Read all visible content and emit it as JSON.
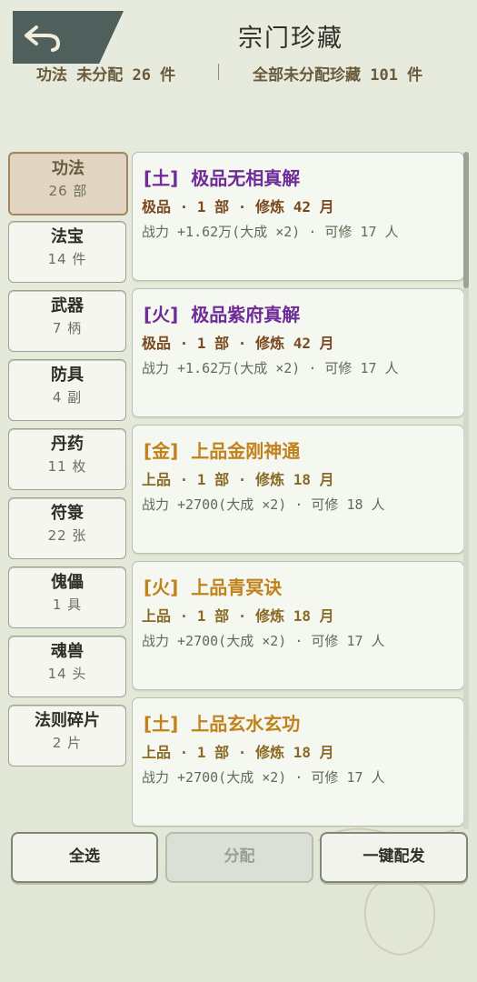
{
  "header": {
    "title": "宗门珍藏",
    "back_icon": "back-arrow-icon"
  },
  "summary": {
    "left": "功法 未分配 26 件",
    "right": "全部未分配珍藏 101 件"
  },
  "categories": [
    {
      "name": "功法",
      "count": "26 部",
      "active": true
    },
    {
      "name": "法宝",
      "count": "14 件"
    },
    {
      "name": "武器",
      "count": "7 柄"
    },
    {
      "name": "防具",
      "count": "4 副"
    },
    {
      "name": "丹药",
      "count": "11 枚"
    },
    {
      "name": "符箓",
      "count": "22 张"
    },
    {
      "name": "傀儡",
      "count": "1 具"
    },
    {
      "name": "魂兽",
      "count": "14 头"
    },
    {
      "name": "法则碎片",
      "count": "2 片"
    }
  ],
  "items": [
    {
      "element": "[土]",
      "name": "极品无相真解",
      "meta": "极品 · 1 部 · 修炼 42 月",
      "power": "战力 +1.62万(大成 ×2) · 可修 17 人",
      "tier_color": "#6f2c98"
    },
    {
      "element": "[火]",
      "name": "极品紫府真解",
      "meta": "极品 · 1 部 · 修炼 42 月",
      "power": "战力 +1.62万(大成 ×2) · 可修 17 人",
      "tier_color": "#6f2c98"
    },
    {
      "element": "[金]",
      "name": "上品金刚神通",
      "meta": "上品 · 1 部 · 修炼 18 月",
      "power": "战力 +2700(大成 ×2) · 可修 18 人",
      "tier_color": "#c1821c"
    },
    {
      "element": "[火]",
      "name": "上品青冥诀",
      "meta": "上品 · 1 部 · 修炼 18 月",
      "power": "战力 +2700(大成 ×2) · 可修 17 人",
      "tier_color": "#c1821c"
    },
    {
      "element": "[土]",
      "name": "上品玄水玄功",
      "meta": "上品 · 1 部 · 修炼 18 月",
      "power": "战力 +2700(大成 ×2) · 可修 17 人",
      "tier_color": "#c1821c"
    }
  ],
  "buttons": {
    "select_all": "全选",
    "assign": "分配",
    "auto_assign": "一键配发"
  }
}
